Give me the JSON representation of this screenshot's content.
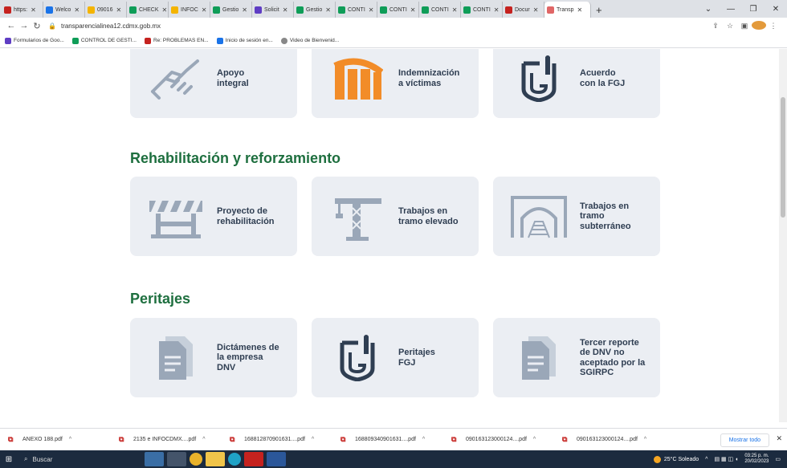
{
  "browser": {
    "tabs": [
      {
        "label": "https:",
        "color": "#c5221f"
      },
      {
        "label": "Welco",
        "color": "#1a73e8"
      },
      {
        "label": "09016",
        "color": "#f4b400"
      },
      {
        "label": "CHECK",
        "color": "#0f9d58"
      },
      {
        "label": "INFOC",
        "color": "#f4b400"
      },
      {
        "label": "Gestio",
        "color": "#0f9d58"
      },
      {
        "label": "Solicit",
        "color": "#5f3dc4"
      },
      {
        "label": "Gestio",
        "color": "#0f9d58"
      },
      {
        "label": "CONTI",
        "color": "#0f9d58"
      },
      {
        "label": "CONTI",
        "color": "#0f9d58"
      },
      {
        "label": "CONTI",
        "color": "#0f9d58"
      },
      {
        "label": "CONTI",
        "color": "#0f9d58"
      },
      {
        "label": "Docur",
        "color": "#c5221f"
      },
      {
        "label": "Transp",
        "color": "#e06666",
        "active": true
      }
    ],
    "new_tab": "+",
    "url": "transparencialinea12.cdmx.gob.mx",
    "bookmarks": [
      {
        "label": "Formularios de Goo...",
        "color": "#5f3dc4"
      },
      {
        "label": "CONTROL DE GESTI...",
        "color": "#0f9d58"
      },
      {
        "label": "Re: PROBLEMAS EN...",
        "color": "#c5221f"
      },
      {
        "label": "Inicio de sesión en...",
        "color": "#1a73e8"
      },
      {
        "label": "Video de Bienvenid...",
        "color": "#888888"
      }
    ]
  },
  "page": {
    "top_cards": [
      {
        "label": "Apoyo\nintegral",
        "icon": "handshake-icon"
      },
      {
        "label": "Indemnización\na víctimas",
        "icon": "metro-logo-icon"
      },
      {
        "label": "Acuerdo\ncon la FGJ",
        "icon": "fgj-logo-icon"
      }
    ],
    "sections": [
      {
        "title": "Rehabilitación y reforzamiento",
        "cards": [
          {
            "label": "Proyecto de\nrehabilitación",
            "icon": "barrier-icon"
          },
          {
            "label": "Trabajos en\ntramo elevado",
            "icon": "crane-icon"
          },
          {
            "label": "Trabajos en\ntramo\nsubterráneo",
            "icon": "tunnel-icon"
          }
        ]
      },
      {
        "title": "Peritajes",
        "cards": [
          {
            "label": "Dictámenes de\nla empresa\nDNV",
            "icon": "document-icon"
          },
          {
            "label": "Peritajes\nFGJ",
            "icon": "fgj-logo-icon"
          },
          {
            "label": "Tercer reporte\nde DNV no\naceptado por la\nSGIRPC",
            "icon": "document-icon"
          }
        ]
      }
    ]
  },
  "downloads": {
    "items": [
      "ANEXO 188.pdf",
      "2135 e INFOCDMX....pdf",
      "168812870901631....pdf",
      "168809340901631....pdf",
      "090163123000124....pdf",
      "090163123000124....pdf"
    ],
    "show_all": "Mostrar todo"
  },
  "taskbar": {
    "search_label": "Buscar",
    "weather": "25°C Soleado",
    "time": "03:25 p. m.",
    "date": "20/02/2023"
  },
  "colors": {
    "accent_green": "#1e6f3f",
    "card_bg": "#ebeef3",
    "metro_orange": "#f28c28",
    "icon_gray": "#9aa7b8"
  }
}
